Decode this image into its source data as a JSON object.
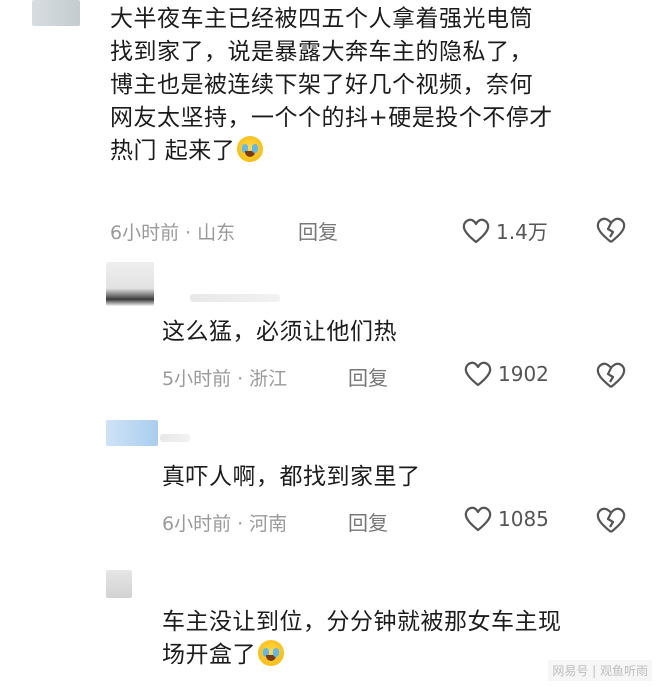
{
  "comments": [
    {
      "lines": [
        "大半夜车主已经被四五个人拿着强光电筒",
        "找到家了，说是暴露大奔车主的隐私了，",
        "博主也是被连续下架了好几个视频，奈何",
        "网友太坚持，一个个的抖+硬是投个不停才",
        "热门 起来了"
      ],
      "time": "6小时前",
      "location": "山东",
      "reply_label": "回复",
      "likes": "1.4万",
      "has_emoji": true
    },
    {
      "lines": [
        "这么猛，必须让他们热"
      ],
      "time": "5小时前",
      "location": "浙江",
      "reply_label": "回复",
      "likes": "1902",
      "has_emoji": false
    },
    {
      "lines": [
        "真吓人啊，都找到家里了"
      ],
      "time": "6小时前",
      "location": "河南",
      "reply_label": "回复",
      "likes": "1085",
      "has_emoji": false
    },
    {
      "lines": [
        "车主没让到位，分分钟就被那女车主现",
        "场开盒了"
      ],
      "has_emoji": true
    }
  ],
  "separator": "·",
  "watermark": "网易号 | 观鱼听雨",
  "icons": {
    "emoji": "crying-laughing-emoji",
    "like": "heart-outline-icon",
    "dislike": "broken-heart-icon"
  }
}
